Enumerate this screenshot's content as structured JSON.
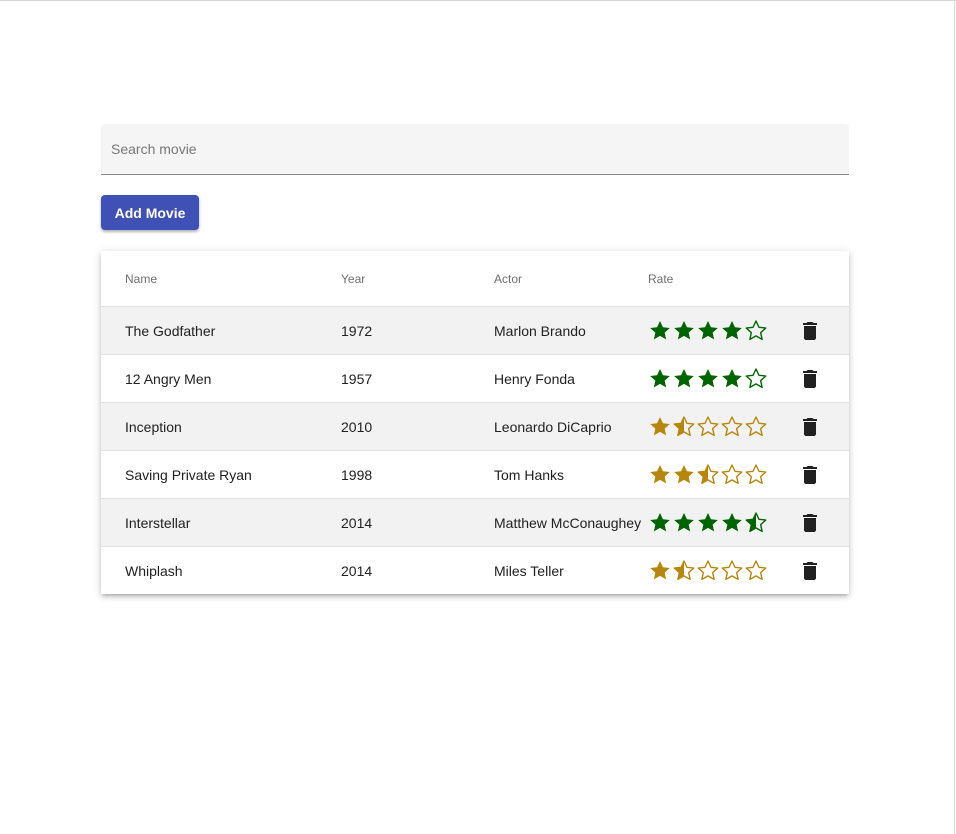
{
  "search": {
    "placeholder": "Search movie",
    "value": ""
  },
  "add_button": {
    "label": "Add Movie"
  },
  "table": {
    "headers": {
      "name": "Name",
      "year": "Year",
      "actor": "Actor",
      "rate": "Rate"
    },
    "rows": [
      {
        "name": "The Godfather",
        "year": "1972",
        "actor": "Marlon Brando",
        "rating": 4,
        "color": "#006400"
      },
      {
        "name": "12 Angry Men",
        "year": "1957",
        "actor": "Henry Fonda",
        "rating": 4,
        "color": "#006400"
      },
      {
        "name": "Inception",
        "year": "2010",
        "actor": "Leonardo DiCaprio",
        "rating": 1.5,
        "color": "#b8860b"
      },
      {
        "name": "Saving Private Ryan",
        "year": "1998",
        "actor": "Tom Hanks",
        "rating": 2.5,
        "color": "#b8860b"
      },
      {
        "name": "Interstellar",
        "year": "2014",
        "actor": "Matthew McConaughey",
        "rating": 4.5,
        "color": "#006400"
      },
      {
        "name": "Whiplash",
        "year": "2014",
        "actor": "Miles Teller",
        "rating": 1.5,
        "color": "#b8860b"
      }
    ]
  },
  "icons": {
    "delete": "trash-icon",
    "star": "star-icon"
  }
}
